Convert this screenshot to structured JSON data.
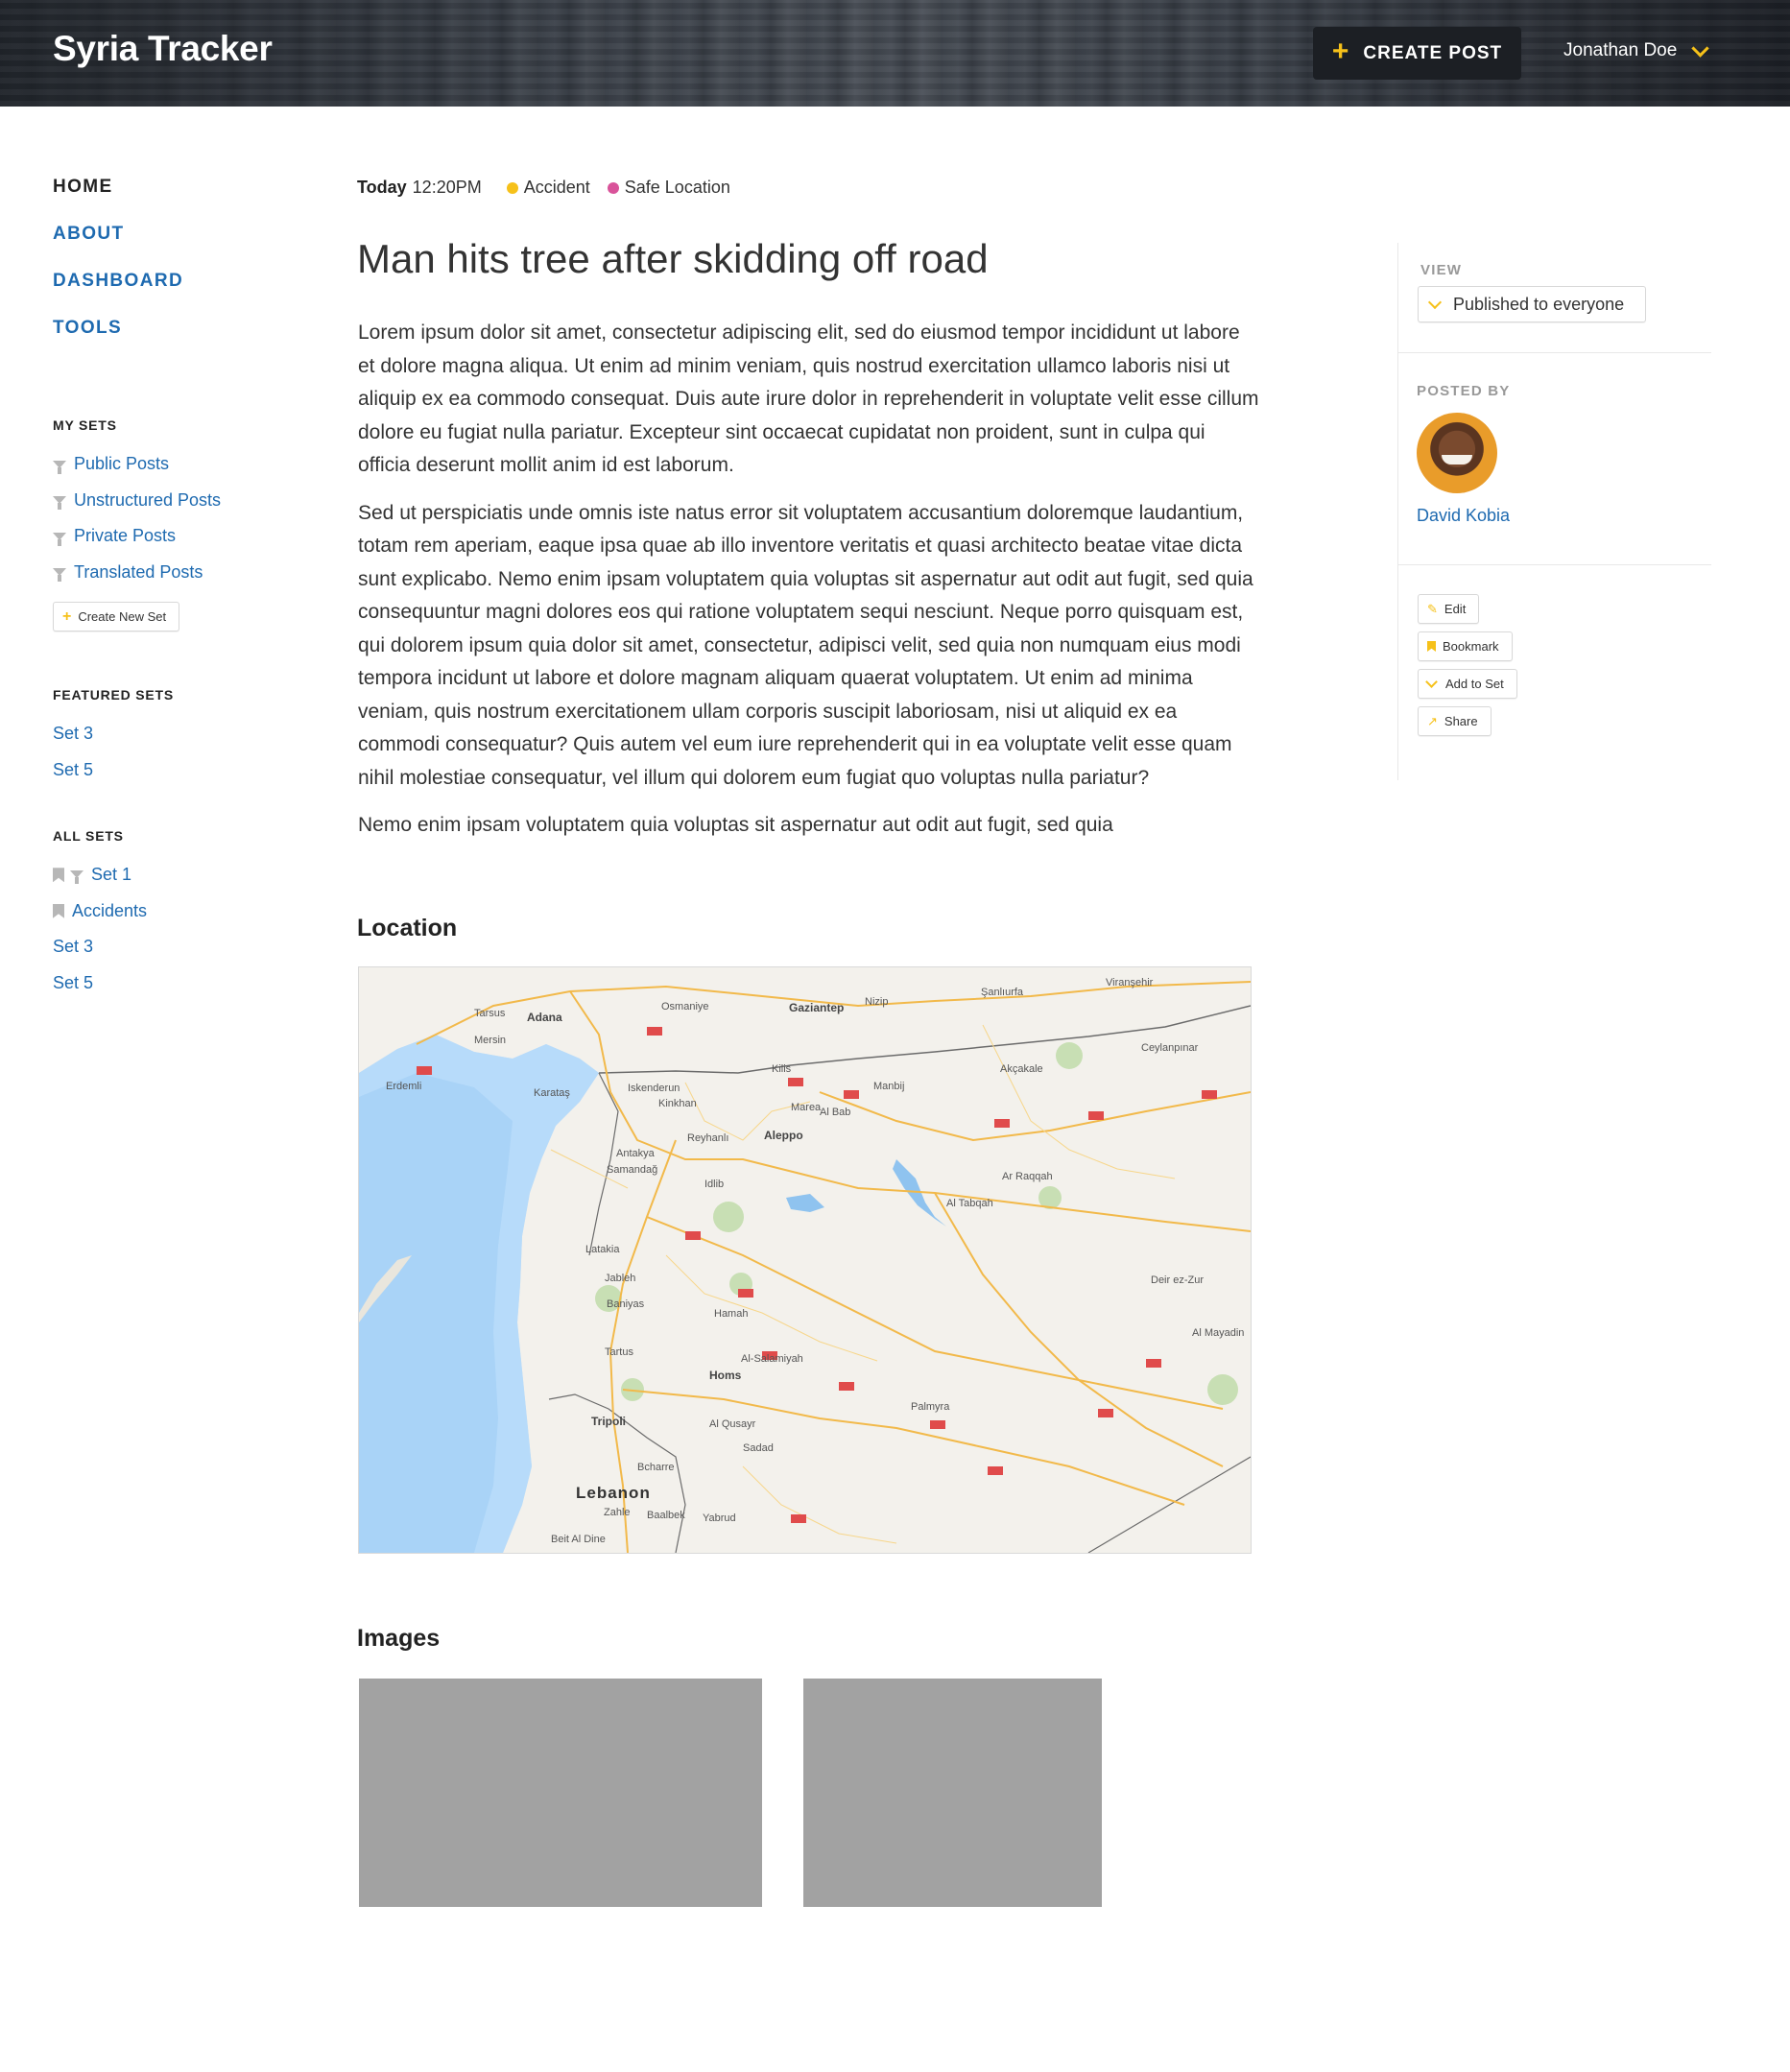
{
  "header": {
    "brand": "Syria Tracker",
    "create_post": "CREATE POST",
    "user_name": "Jonathan Doe"
  },
  "nav": {
    "main": [
      "HOME",
      "ABOUT",
      "DASHBOARD",
      "TOOLS"
    ]
  },
  "my_sets": {
    "heading": "MY SETS",
    "items": [
      "Public Posts",
      "Unstructured Posts",
      "Private Posts",
      "Translated Posts"
    ],
    "create_label": "Create New Set"
  },
  "featured_sets": {
    "heading": "FEATURED SETS",
    "items": [
      "Set 3",
      "Set 5"
    ]
  },
  "all_sets": {
    "heading": "ALL SETS",
    "items": [
      "Set 1",
      "Accidents",
      "Set 3",
      "Set 5"
    ]
  },
  "post": {
    "date_label": "Today",
    "time": "12:20PM",
    "tags": [
      {
        "label": "Accident",
        "color": "#f6c11a"
      },
      {
        "label": "Safe Location",
        "color": "#d9539a"
      }
    ],
    "title": "Man hits tree after skidding off road",
    "paragraphs": [
      "Lorem ipsum dolor sit amet, consectetur adipiscing elit, sed do eiusmod tempor incididunt ut labore et dolore magna aliqua. Ut enim ad minim veniam, quis nostrud exercitation ullamco laboris nisi ut aliquip ex ea commodo consequat. Duis aute irure dolor in reprehenderit in voluptate velit esse cillum dolore eu fugiat nulla pariatur. Excepteur sint occaecat cupidatat non proident, sunt in culpa qui officia deserunt mollit anim id est laborum.",
      "Sed ut perspiciatis unde omnis iste natus error sit voluptatem accusantium doloremque laudantium, totam rem aperiam, eaque ipsa quae ab illo inventore veritatis et quasi architecto beatae vitae dicta sunt explicabo. Nemo enim ipsam voluptatem quia voluptas sit aspernatur aut odit aut fugit, sed quia consequuntur magni dolores eos qui ratione voluptatem sequi nesciunt. Neque porro quisquam est, qui dolorem ipsum quia dolor sit amet, consectetur, adipisci velit, sed quia non numquam eius modi tempora incidunt ut labore et dolore magnam aliquam quaerat voluptatem. Ut enim ad minima veniam, quis nostrum exercitationem ullam corporis suscipit laboriosam, nisi ut aliquid ex ea commodi consequatur? Quis autem vel eum iure reprehenderit qui in ea voluptate velit esse quam nihil molestiae consequatur, vel illum qui dolorem eum fugiat quo voluptas nulla pariatur?",
      "Nemo enim ipsam voluptatem quia voluptas sit aspernatur aut odit aut fugit, sed quia"
    ],
    "location_heading": "Location",
    "images_heading": "Images"
  },
  "map": {
    "labels": [
      "Adana",
      "Gaziantep",
      "Şanlıurfa",
      "Osmaniye",
      "Aleppo",
      "Idlib",
      "Ar Raqqah",
      "Latakia",
      "Hamah",
      "Homs",
      "Tartus",
      "Tripoli",
      "Lebanon",
      "Zahle",
      "Deir ez-Zur",
      "Palmyra",
      "Al-Salamiyah",
      "Al Mayadin",
      "Kilis",
      "Manbij",
      "Iskenderun",
      "Antakya",
      "Mersin",
      "Tarsus",
      "Viranşehir",
      "Ceylanpınar",
      "Akçakale",
      "Al Tabqah",
      "Jableh",
      "Baniyas",
      "Baalbek",
      "Al Qusayr",
      "Sadad",
      "Yabrud",
      "Beit Al Dine",
      "Bcharre",
      "Marea",
      "Al Bab",
      "Nizip",
      "Erdemli",
      "Karataş",
      "Samandağ",
      "Reyhanlı",
      "Kinkhan"
    ]
  },
  "right_panel": {
    "view_label": "VIEW",
    "view_value": "Published to everyone",
    "posted_by_label": "POSTED BY",
    "author": "David Kobia",
    "actions": [
      "Edit",
      "Bookmark",
      "Add to Set",
      "Share"
    ]
  }
}
